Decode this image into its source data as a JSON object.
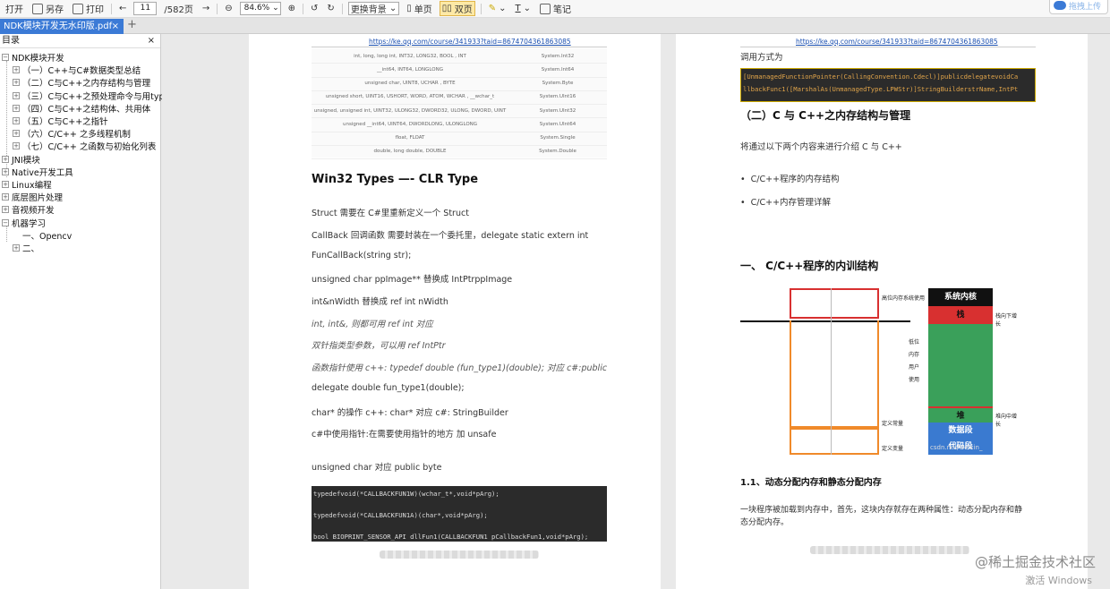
{
  "toolbar": {
    "open": "打开",
    "save_as": "另存",
    "print": "打印",
    "page_current": "11",
    "page_total": "/582页",
    "zoom": "84.6%",
    "bg": "更换背景",
    "single": "单页",
    "double": "双页",
    "note": "笔记",
    "upload": "拖拽上传"
  },
  "tab": {
    "title": "NDK模块开发无水印版.pdf",
    "close": "×",
    "add": "+"
  },
  "sidebar": {
    "title": "目录",
    "close": "×",
    "items": [
      {
        "label": "NDK模块开发",
        "exp": "−"
      },
      {
        "label": "（一）C++与C#数据类型总结",
        "exp": "+"
      },
      {
        "label": "（二）C与C++之内存结构与管理",
        "exp": "+"
      },
      {
        "label": "（三）C与C++之预处理命令与用typede",
        "exp": "+"
      },
      {
        "label": "（四）C与C++之结构体、共用体",
        "exp": "+"
      },
      {
        "label": "（五）C与C++之指针",
        "exp": "+"
      },
      {
        "label": "（六）C/C++ 之多线程机制",
        "exp": "+"
      },
      {
        "label": "（七）C/C++ 之函数与初始化列表",
        "exp": "+"
      },
      {
        "label": "JNI模块",
        "exp": "+"
      },
      {
        "label": "Native开发工具",
        "exp": "+"
      },
      {
        "label": "Linux编程",
        "exp": "+"
      },
      {
        "label": "底层图片处理",
        "exp": "+"
      },
      {
        "label": "音视频开发",
        "exp": "+"
      },
      {
        "label": "机器学习",
        "exp": "−"
      },
      {
        "label": "一、Opencv",
        "exp": ""
      },
      {
        "label": "二、",
        "exp": "+"
      }
    ]
  },
  "left_page": {
    "url": "https://ke.qq.com/course/341933?taid=8674704361863085",
    "table": [
      [
        "int, long, long int, INT32, LONG32, BOOL , INT",
        "System.Int32"
      ],
      [
        "__int64, INT64, LONGLONG",
        "System.Int64"
      ],
      [
        "unsigned char, UINT8, UCHAR , BYTE",
        "System.Byte"
      ],
      [
        "unsigned short, UINT16, USHORT, WORD, ATOM, WCHAR , __wchar_t",
        "System.UInt16"
      ],
      [
        "unsigned, unsigned int, UINT32, ULONG32, DWORD32, ULONG, DWORD, UINT",
        "System.UInt32"
      ],
      [
        "unsigned __int64, UINT64, DWORDLONG, ULONGLONG",
        "System.UInt64"
      ],
      [
        "float, FLOAT",
        "System.Single"
      ],
      [
        "double, long double, DOUBLE",
        "System.Double"
      ]
    ],
    "heading": "Win32 Types —- CLR Type",
    "lines": [
      "Struct 需要在 C#里重新定义一个 Struct",
      "CallBack 回调函数 需要封装在一个委托里，delegate static extern int",
      "FunCallBack(string str);",
      "unsigned char ppImage** 替换成 IntPtrppImage",
      "int&nWidth 替换成 ref int nWidth",
      "int, int&, 则都可用 ref int 对应",
      "双针指类型参数，可以用 ref IntPtr",
      "函数指针使用 c++: typedef double (fun_type1)(double); 对应 c#:public",
      "delegate double fun_type1(double);",
      "char* 的操作 c++: char* 对应 c#: StringBuilder",
      "c#中使用指针:在需要使用指针的地方 加 unsafe",
      "unsigned char 对应 public byte"
    ],
    "code": [
      "typedefvoid(*CALLBACKFUN1W)(wchar_t*,void*pArg);",
      "typedefvoid(*CALLBACKFUN1A)(char*,void*pArg);",
      " bool BIOPRINT_SENSOR_API dllFun1(CALLBACKFUN1 pCallbackFun1,void*pArg);"
    ]
  },
  "right_page": {
    "url": "https://ke.qq.com/course/341933?taid=8674704361863085",
    "call_text": "调用方式为",
    "code": [
      "[UnmanagedFunctionPointer(CallingConvention.Cdecl)]publicdelegatevoidCa",
      "llbackFunc1([MarshalAs(UnmanagedType.LPWStr)]StringBuilderstrName,IntPt"
    ],
    "h_section": "（二）C 与 C++之内存结构与管理",
    "intro": "将通过以下两个内容来进行介绍 C 与 C++",
    "bullets": [
      "C/C++程序的内存结构",
      "C/C++内存管理详解"
    ],
    "h_one": "一、  C/C++程序的内训结构",
    "diagram": {
      "kernel": "系统内核",
      "stack": "栈",
      "stack_dir": "栈向下增长",
      "heap": "堆",
      "heap_dir": "堆向中增长",
      "data": "数据段",
      "code": "代码段",
      "high_note": "高位内存系统使用",
      "low_note": "低位内存用户使用",
      "const_note": "定义常量",
      "var_note": "定义变量",
      "site": "csdn.net/weixin_"
    },
    "sub_heading": "1.1、动态分配内存和静态分配内存",
    "para": [
      "一块程序被加载到内存中，首先，这块内存就存在两种属性：动态分配内存和静",
      "态分配内存。"
    ]
  },
  "watermark": "@稀土掘金技术社区",
  "windows": "激活 Windows",
  "colors": {
    "tab": "#3b7ad6",
    "green": "#3aa05a",
    "red": "#d83030",
    "kernel": "#111111",
    "blue": "#3a7ad0",
    "orange": "#f08a2a"
  }
}
